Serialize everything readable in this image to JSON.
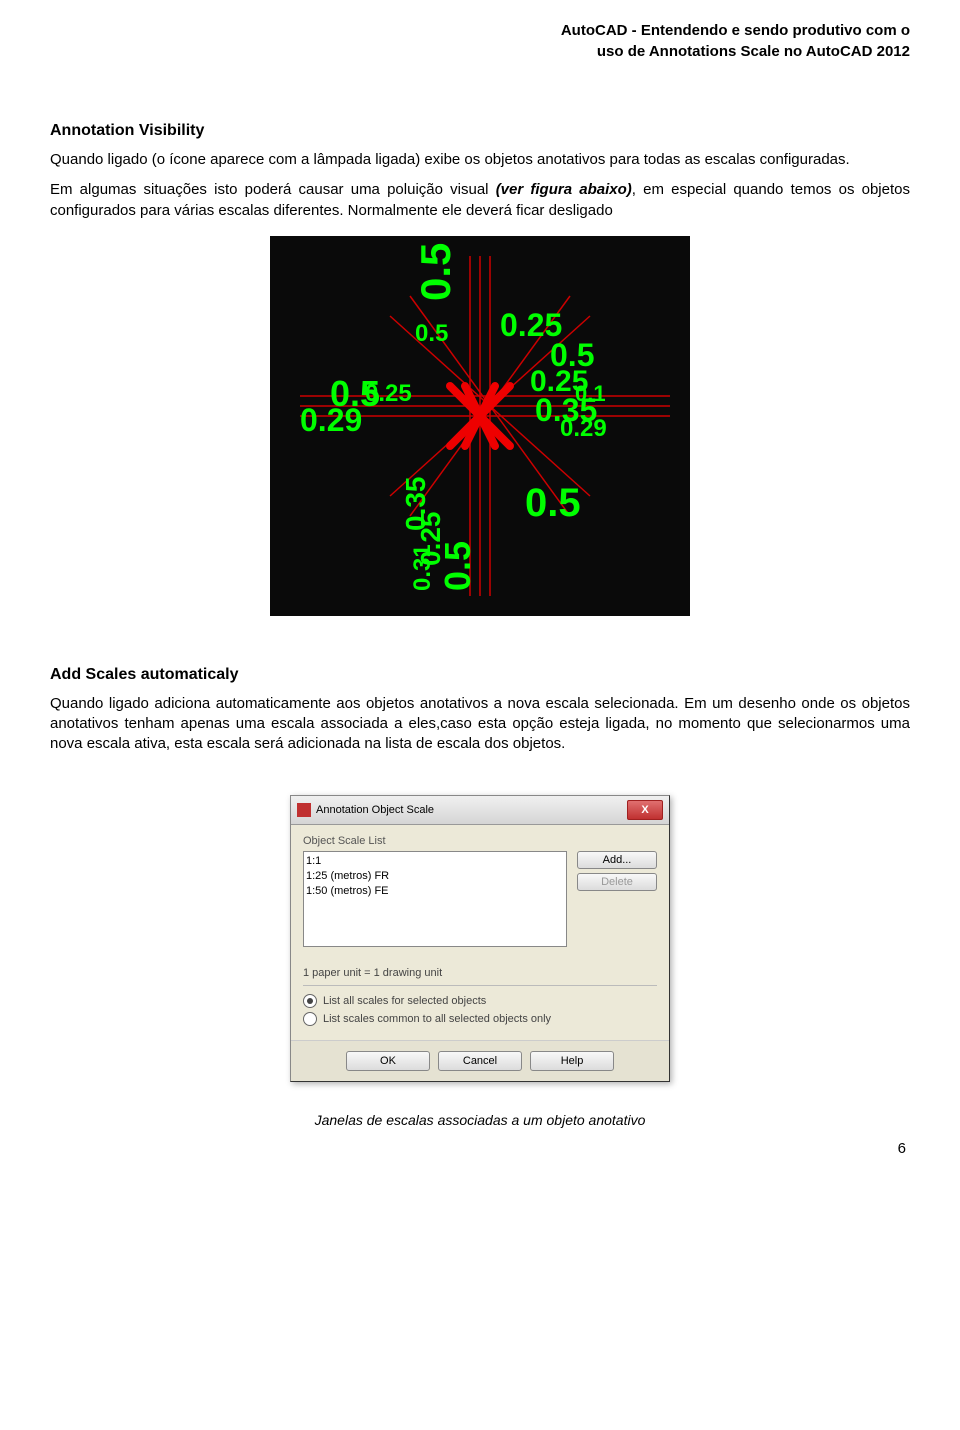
{
  "header": {
    "line1": "AutoCAD - Entendendo e sendo produtivo com o",
    "line2": "uso de Annotations Scale no AutoCAD 2012"
  },
  "section1": {
    "title": "Annotation Visibility",
    "para1": "Quando ligado (o ícone aparece com a lâmpada ligada) exibe os objetos anotativos para todas as escalas configuradas.",
    "para2a": "Em algumas situações isto poderá causar uma poluição visual ",
    "para2b_italic": "(ver figura abaixo)",
    "para2c": ", em especial quando temos os objetos configurados para várias escalas diferentes. Normalmente ele deverá ficar desligado"
  },
  "cad_labels": [
    "0.5",
    "0.5",
    "0.5",
    "0.5",
    "0.25",
    "0.25",
    "0.29",
    "0.5",
    "0.35",
    "0.29",
    "0.31",
    "0.5",
    "0.25",
    "0.5",
    "0.35",
    "0.1"
  ],
  "section2": {
    "title": "Add Scales automaticaly",
    "para1": "Quando ligado adiciona automaticamente aos objetos anotativos a nova escala selecionada. Em um desenho onde os objetos anotativos tenham apenas uma escala associada a eles,caso esta opção esteja ligada, no momento que selecionarmos uma nova escala ativa, esta escala será adicionada na lista de escala dos objetos."
  },
  "dialog": {
    "title": "Annotation Object Scale",
    "list_label": "Object Scale List",
    "items": [
      "1:1",
      "1:25 (metros) FR",
      "1:50 (metros) FE"
    ],
    "add_btn": "Add...",
    "delete_btn": "Delete",
    "units_text": "1 paper unit = 1 drawing unit",
    "radio1": "List all scales for selected objects",
    "radio2": "List scales common to all selected objects only",
    "ok": "OK",
    "cancel": "Cancel",
    "help": "Help"
  },
  "caption": "Janelas de escalas associadas a um objeto anotativo",
  "page_number": "6"
}
